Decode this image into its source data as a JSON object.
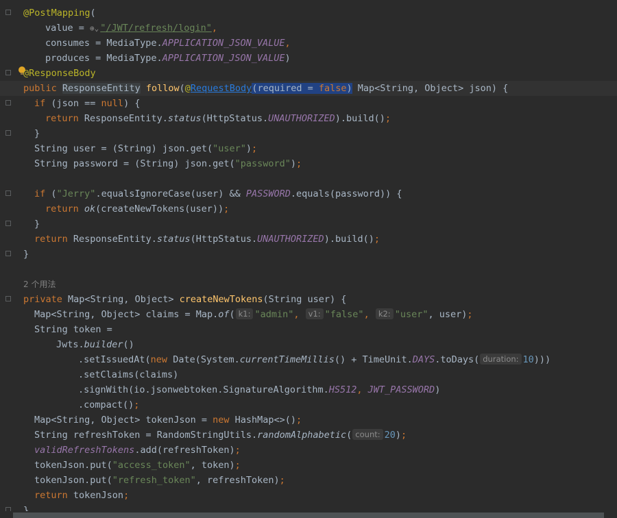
{
  "editor": {
    "lines": {
      "l1": {
        "ann": "@PostMapping",
        "rest": "("
      },
      "l2": {
        "a": "value = ",
        "str": "\"/JWT/refresh/login\"",
        "b": ","
      },
      "l3": {
        "a": "consumes = MediaType.",
        "const": "APPLICATION_JSON_VALUE",
        "b": ","
      },
      "l4": {
        "a": "produces = MediaType.",
        "const": "APPLICATION_JSON_VALUE",
        "b": ")"
      },
      "l5": {
        "ann": "@ResponseBody"
      },
      "l6": {
        "kw": "public ",
        "type": "ResponseEntity",
        "sp": " ",
        "fn": "follow",
        "p1": "(",
        "at": "@",
        "link": "RequestBody",
        "sel1": "(required = ",
        "sel2": "false",
        "sel3": ")",
        "rest": " Map<String, Object> json) {"
      },
      "l7": {
        "kw": "if ",
        "a": "(json == ",
        "kw2": "null",
        "b": ") {"
      },
      "l8": {
        "kw": "return ",
        "a": "ResponseEntity.",
        "it": "status",
        "b": "(HttpStatus.",
        "const": "UNAUTHORIZED",
        "c": ").build()",
        "semi": ";"
      },
      "l9": {
        "a": "}"
      },
      "l10": {
        "a": "String user = (String) json.get(",
        "str": "\"user\"",
        "b": ")",
        "semi": ";"
      },
      "l11": {
        "a": "String password = (String) json.get(",
        "str": "\"password\"",
        "b": ")",
        "semi": ";"
      },
      "l12": {
        "kw": "if ",
        "a": "(",
        "str": "\"Jerry\"",
        "b": ".equalsIgnoreCase(user) && ",
        "const": "PASSWORD",
        "c": ".equals(password)) {"
      },
      "l13": {
        "kw": "return ",
        "it": "ok",
        "a": "(createNewTokens(user))",
        "semi": ";"
      },
      "l14": {
        "a": "}"
      },
      "l15": {
        "kw": "return ",
        "a": "ResponseEntity.",
        "it": "status",
        "b": "(HttpStatus.",
        "const": "UNAUTHORIZED",
        "c": ").build()",
        "semi": ";"
      },
      "l16": {
        "a": "}"
      },
      "l17": {
        "comment": "2 个用法"
      },
      "l18": {
        "kw": "private ",
        "a": "Map<String, Object> ",
        "fn": "createNewTokens",
        "b": "(String user) {"
      },
      "l19": {
        "a": "Map<String, Object> claims = Map.",
        "it": "of",
        "p": "(",
        "h1": "k1:",
        "s1": "\"admin\"",
        "c1": ", ",
        "h2": "v1:",
        "s2": "\"false\"",
        "c2": ", ",
        "h3": "k2:",
        "s3": "\"user\"",
        "c3": ", user)",
        "semi": ";"
      },
      "l20": {
        "a": "String token ="
      },
      "l21": {
        "a": "Jwts.",
        "it": "builder",
        "b": "()"
      },
      "l22": {
        "a": ".setIssuedAt(",
        "kw": "new ",
        "b": "Date(System.",
        "it": "currentTimeMillis",
        "c": "() + TimeUnit.",
        "const": "DAYS",
        "d": ".toDays(",
        "h": "duration:",
        "num": "10",
        "e": ")))"
      },
      "l23": {
        "a": ".setClaims(claims)"
      },
      "l24": {
        "a": ".signWith(io.jsonwebtoken.SignatureAlgorithm.",
        "const": "HS512",
        "b": ", ",
        "const2": "JWT_PASSWORD",
        "c": ")"
      },
      "l25": {
        "a": ".compact()",
        "semi": ";"
      },
      "l26": {
        "a": "Map<String, Object> tokenJson = ",
        "kw": "new ",
        "b": "HashMap<>()",
        "semi": ";"
      },
      "l27": {
        "a": "String refreshToken = RandomStringUtils.",
        "it": "randomAlphabetic",
        "p": "(",
        "h": "count:",
        "num": "20",
        "b": ")",
        "semi": ";"
      },
      "l28": {
        "field": "validRefreshTokens",
        "a": ".add(refreshToken)",
        "semi": ";"
      },
      "l29": {
        "a": "tokenJson.put(",
        "str": "\"access_token\"",
        "b": ", token)",
        "semi": ";"
      },
      "l30": {
        "a": "tokenJson.put(",
        "str": "\"refresh_token\"",
        "b": ", refreshToken)",
        "semi": ";"
      },
      "l31": {
        "kw": "return ",
        "a": "tokenJson",
        "semi": ";"
      },
      "l32": {
        "a": "}"
      }
    }
  }
}
